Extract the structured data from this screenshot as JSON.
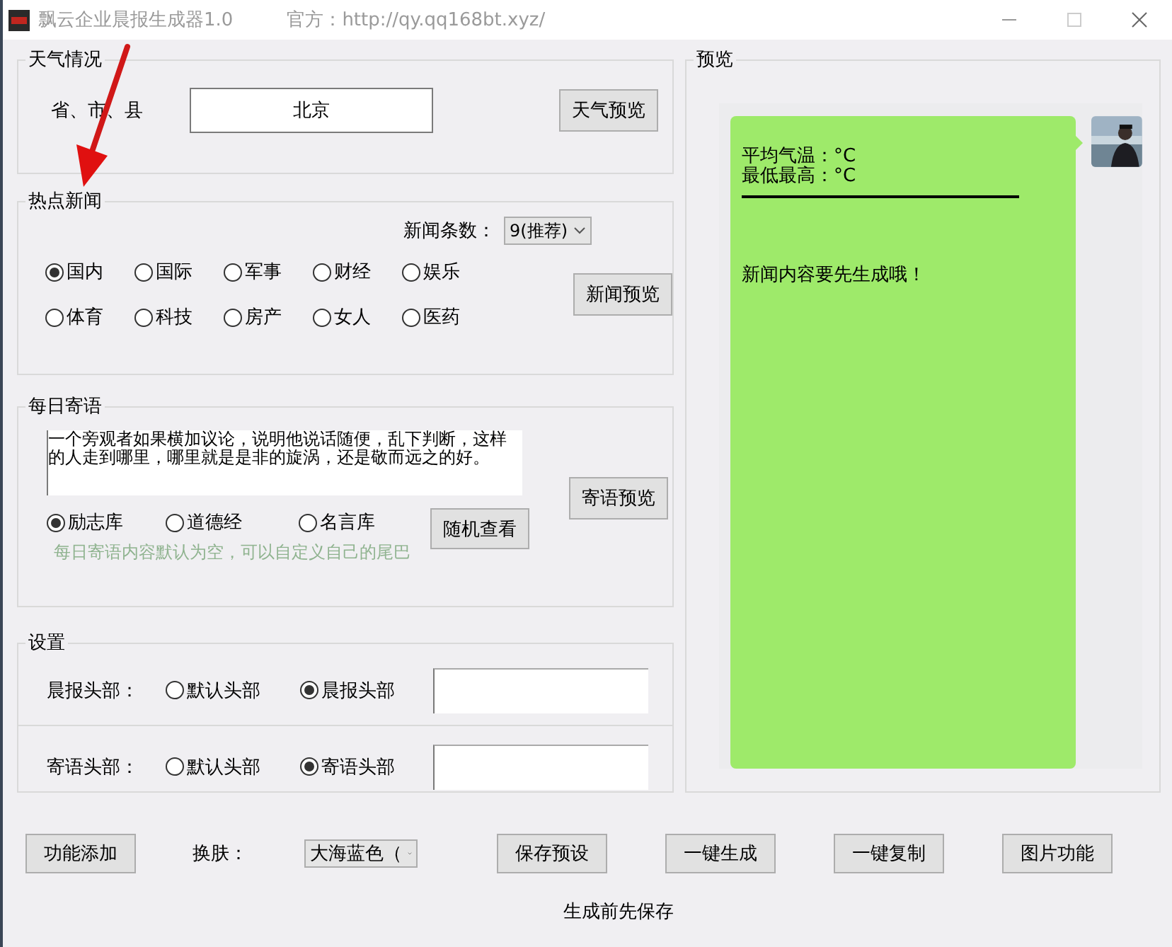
{
  "window": {
    "title": "飘云企业晨报生成器1.0",
    "website": "官方：http://qy.qq168bt.xyz/"
  },
  "weather": {
    "title": "天气情况",
    "label": "省、市、县",
    "value": "北京",
    "button": "天气预览"
  },
  "news": {
    "title": "热点新闻",
    "count_label": "新闻条数：",
    "count_value": "9(推荐)",
    "button": "新闻预览",
    "categories": [
      {
        "label": "国内",
        "selected": true
      },
      {
        "label": "国际",
        "selected": false
      },
      {
        "label": "军事",
        "selected": false
      },
      {
        "label": "财经",
        "selected": false
      },
      {
        "label": "娱乐",
        "selected": false
      },
      {
        "label": "体育",
        "selected": false
      },
      {
        "label": "科技",
        "selected": false
      },
      {
        "label": "房产",
        "selected": false
      },
      {
        "label": "女人",
        "selected": false
      },
      {
        "label": "医药",
        "selected": false
      }
    ]
  },
  "daily": {
    "title": "每日寄语",
    "text": "一个旁观者如果横加议论，说明他说话随便，乱下判断，这样的人走到哪里，哪里就是是非的旋涡，还是敬而远之的好。",
    "button": "寄语预览",
    "random_button": "随机查看",
    "hint": "每日寄语内容默认为空，可以自定义自己的尾巴",
    "sources": [
      {
        "label": "励志库",
        "selected": true
      },
      {
        "label": "道德经",
        "selected": false
      },
      {
        "label": "名言库",
        "selected": false
      }
    ]
  },
  "settings": {
    "title": "设置",
    "rows": [
      {
        "label": "晨报头部：",
        "options": [
          {
            "label": "默认头部",
            "selected": false
          },
          {
            "label": "晨报头部",
            "selected": true
          }
        ]
      },
      {
        "label": "寄语头部：",
        "options": [
          {
            "label": "默认头部",
            "selected": false
          },
          {
            "label": "寄语头部",
            "selected": true
          }
        ]
      }
    ]
  },
  "preview": {
    "title": "预览",
    "lines": [
      "平均气温：°C",
      "最低最高：°C"
    ],
    "news_text": "新闻内容要先生成哦！"
  },
  "footer": {
    "add_button": "功能添加",
    "skin_label": "换肤：",
    "skin_value": "大海蓝色（",
    "buttons": [
      "保存预设",
      "一键生成",
      "一键复制",
      "图片功能"
    ],
    "note": "生成前先保存"
  }
}
